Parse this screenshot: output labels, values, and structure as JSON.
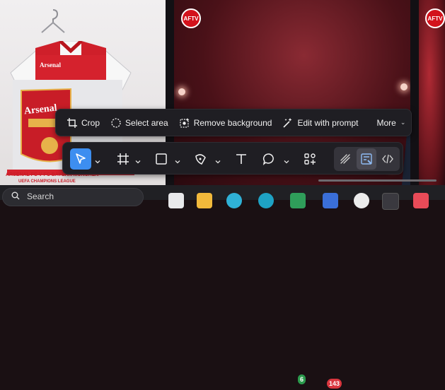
{
  "photos": {
    "left": {
      "shirt_logo": "Arsenal",
      "shirt_crest": "Arsenal",
      "scarf_line_1": "ARSENAL FC V FC BAYERN MÜNCHEN",
      "scarf_line_2": "UEFA CHAMPIONS LEAGUE"
    },
    "channel_badge": "AFTV"
  },
  "image_actions": {
    "crop": "Crop",
    "select_area": "Select area",
    "remove_background": "Remove background",
    "edit_with_prompt": "Edit with prompt",
    "more": "More"
  },
  "toolbar": {
    "tools": [
      "select-tool",
      "crop-tool",
      "shape-tool",
      "highlighter-tool",
      "text-tool",
      "comment-tool",
      "insert-tool",
      "draw-tool",
      "fill-tool",
      "code-tool"
    ]
  },
  "taskbar": {
    "search_placeholder": "Search",
    "notification_count": "6",
    "mail_count": "143"
  },
  "colors": {
    "accent": "#3d8ef0",
    "toolbar_bg": "#1f1e23",
    "badge_green": "#2b9a4c",
    "badge_red": "#d9363e",
    "afty_red": "#d3121c"
  }
}
